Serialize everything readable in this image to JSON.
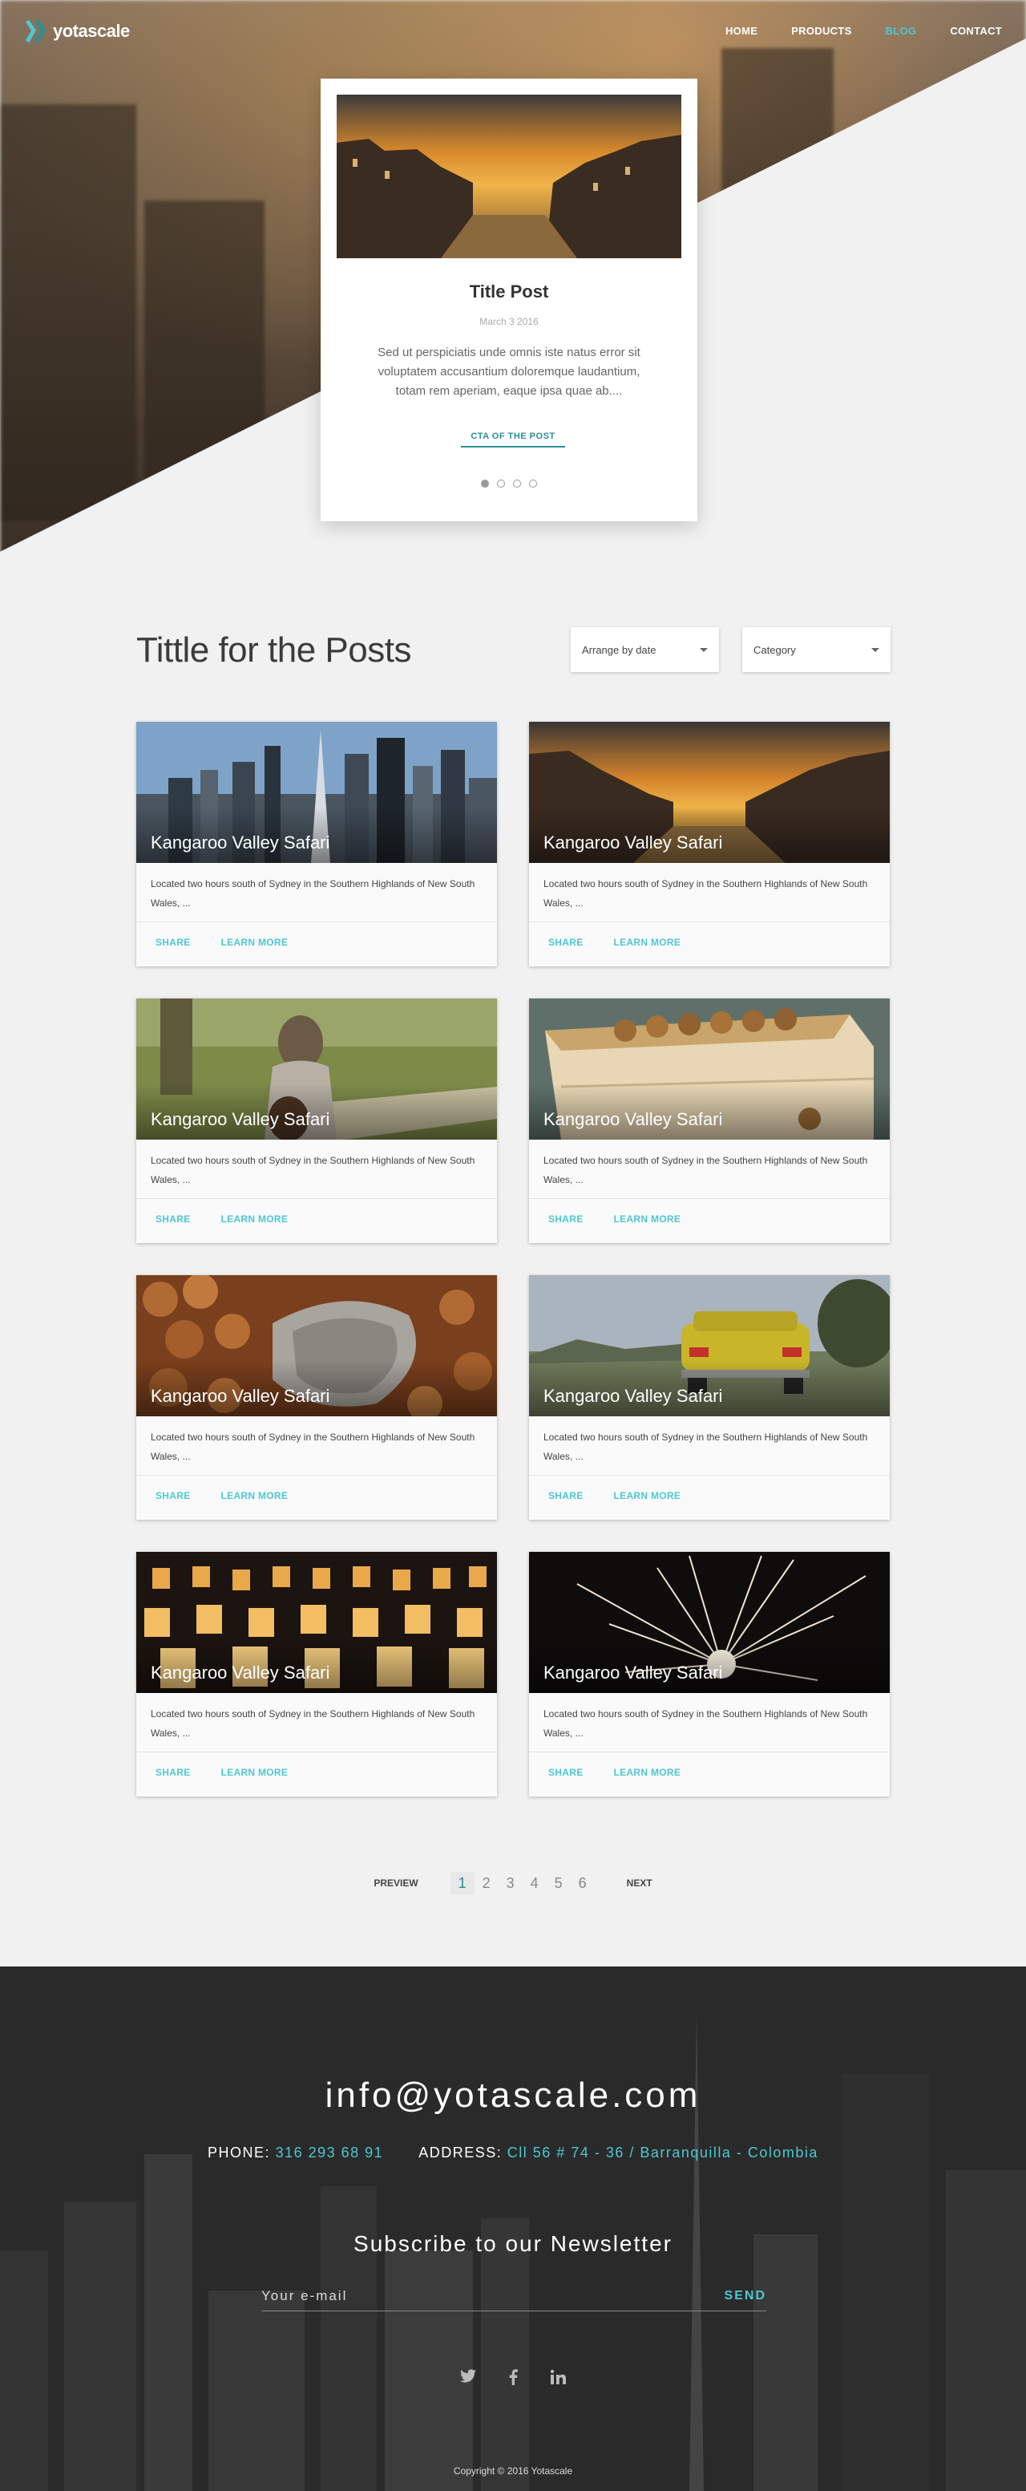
{
  "nav": {
    "logo": "yotascale",
    "links": [
      "HOME",
      "PRODUCTS",
      "BLOG",
      "CONTACT"
    ],
    "active": "BLOG"
  },
  "feature": {
    "title": "Title Post",
    "date": "March 3 2016",
    "excerpt": "Sed ut perspiciatis unde omnis iste natus error sit voluptatem accusantium doloremque laudantium, totam rem aperiam, eaque ipsa quae ab....",
    "cta": "CTA OF THE POST",
    "slides": 4,
    "current_slide": 1
  },
  "posts": {
    "title": "Tittle for the Posts",
    "sort_select": "Arrange by date",
    "category_select": "Category",
    "cards": [
      {
        "title": "Kangaroo Valley Safari",
        "text": "Located two hours south of Sydney in the Southern Highlands of New South Wales, ...",
        "share": "SHARE",
        "learn": "LEARN MORE",
        "image": "city-skyline"
      },
      {
        "title": "Kangaroo Valley Safari",
        "text": "Located two hours south of Sydney in the Southern Highlands of New South Wales, ...",
        "share": "SHARE",
        "learn": "LEARN MORE",
        "image": "canal-sunset"
      },
      {
        "title": "Kangaroo Valley Safari",
        "text": "Located two hours south of Sydney in the Southern Highlands of New South Wales, ...",
        "share": "SHARE",
        "learn": "LEARN MORE",
        "image": "girl-guitar"
      },
      {
        "title": "Kangaroo Valley Safari",
        "text": "Located two hours south of Sydney in the Southern Highlands of New South Wales, ...",
        "share": "SHARE",
        "learn": "LEARN MORE",
        "image": "walnut-crate"
      },
      {
        "title": "Kangaroo Valley Safari",
        "text": "Located two hours south of Sydney in the Southern Highlands of New South Wales, ...",
        "share": "SHARE",
        "learn": "LEARN MORE",
        "image": "hazelnut-scoop"
      },
      {
        "title": "Kangaroo Valley Safari",
        "text": "Located two hours south of Sydney in the Southern Highlands of New South Wales, ...",
        "share": "SHARE",
        "learn": "LEARN MORE",
        "image": "yellow-car"
      },
      {
        "title": "Kangaroo Valley Safari",
        "text": "Located two hours south of Sydney in the Southern Highlands of New South Wales, ...",
        "share": "SHARE",
        "learn": "LEARN MORE",
        "image": "lanterns"
      },
      {
        "title": "Kangaroo Valley Safari",
        "text": "Located two hours south of Sydney in the Southern Highlands of New South Wales, ...",
        "share": "SHARE",
        "learn": "LEARN MORE",
        "image": "sparkler"
      }
    ]
  },
  "pagination": {
    "prev": "PREVIEW",
    "next": "NEXT",
    "pages": [
      "1",
      "2",
      "3",
      "4",
      "5",
      "6"
    ],
    "current": "1"
  },
  "footer": {
    "email": "info@yotascale.com",
    "phone_label": "PHONE:",
    "phone": "316 293 68 91",
    "address_label": "ADDRESS:",
    "address": "Cll 56 # 74 - 36 / Barranquilla - Colombia",
    "newsletter_title": "Subscribe to our Newsletter",
    "email_placeholder": "Your e-mail",
    "send": "SEND",
    "socials": [
      "twitter-icon",
      "facebook-icon",
      "linkedin-icon"
    ],
    "copyright": "Copyright © 2016 Yotascale"
  },
  "colors": {
    "accent": "#4ec7d2",
    "accent_dark": "#2b8f95",
    "background": "#f1f1f1",
    "footer": "#2a2a2a"
  }
}
